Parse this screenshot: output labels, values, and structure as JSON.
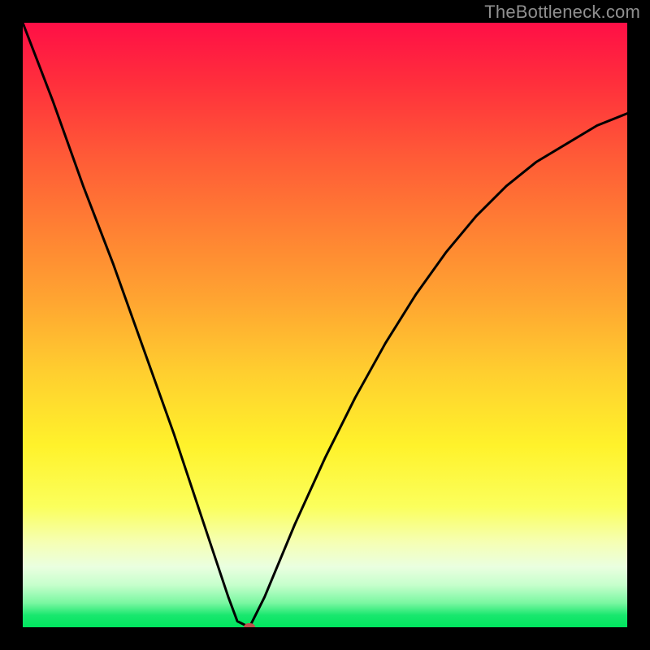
{
  "attribution": "TheBottleneck.com",
  "colors": {
    "page_bg": "#000000",
    "curve_stroke": "#000000",
    "marker_fill": "#c0504d",
    "gradient_top": "#ff0f46",
    "gradient_bottom": "#00e55f"
  },
  "chart_data": {
    "type": "line",
    "title": "",
    "xlabel": "",
    "ylabel": "",
    "xlim": [
      0,
      100
    ],
    "ylim": [
      0,
      100
    ],
    "x": [
      0,
      5,
      10,
      15,
      20,
      25,
      28,
      31,
      34,
      35.5,
      37.5,
      40,
      45,
      50,
      55,
      60,
      65,
      70,
      75,
      80,
      85,
      90,
      95,
      100
    ],
    "y": [
      100,
      87,
      73,
      60,
      46,
      32,
      23,
      14,
      5,
      1,
      0,
      5,
      17,
      28,
      38,
      47,
      55,
      62,
      68,
      73,
      77,
      80,
      83,
      85
    ],
    "marker": {
      "x": 37.5,
      "y": 0
    },
    "grid": false,
    "legend": false
  }
}
